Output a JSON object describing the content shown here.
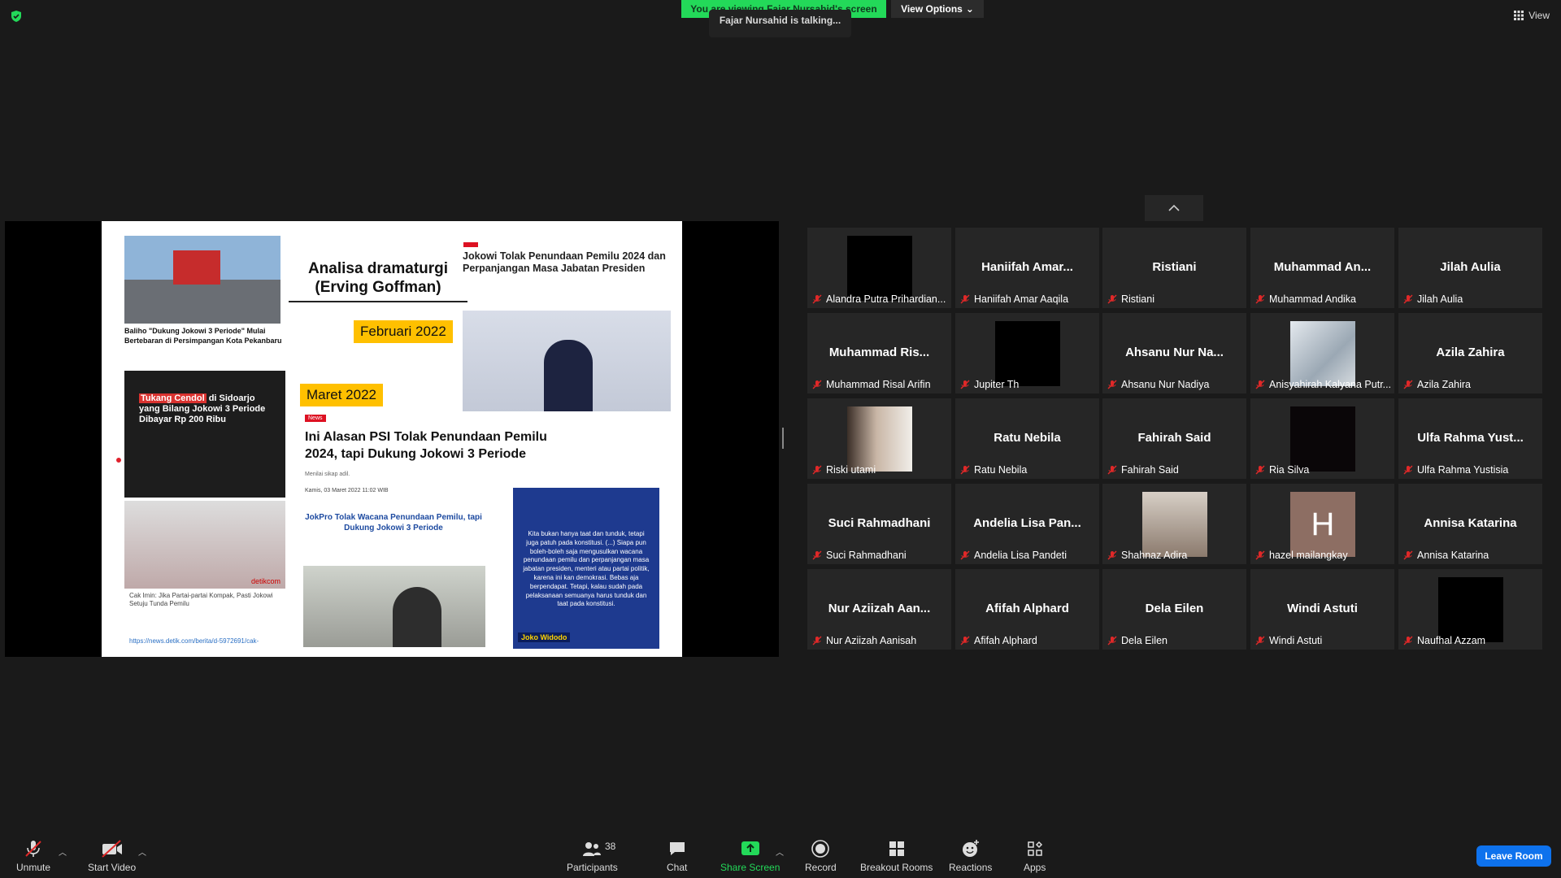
{
  "banner": {
    "viewing": "You are viewing Fajar Nursahid's screen",
    "view_options": "View Options",
    "talking": "Fajar Nursahid is talking...",
    "view": "View"
  },
  "slide": {
    "title": "Analisa dramaturgi (Erving Goffman)",
    "label_feb": "Februari 2022",
    "label_mar": "Maret 2022",
    "cap1": "Baliho \"Dukung Jokowi 3 Periode\" Mulai Bertebaran di Persimpangan Kota Pekanbaru",
    "head2": "Jokowi Tolak Penundaan Pemilu 2024 dan Perpanjangan Masa Jabatan Presiden",
    "dark_hl": "Tukang Cendol",
    "dark_rest": "di Sidoarjo yang Bilang Jokowi 3 Periode Dibayar Rp 200 Ribu",
    "news_tag": "News",
    "head3": "Ini Alasan PSI Tolak Penundaan Pemilu 2024, tapi Dukung Jokowi 3 Periode",
    "sub3": "Menilai sikap adil.",
    "date3": "Kamis, 03 Maret 2022 11:02 WIB",
    "cap4": "Cak Imin: Jika Partai-partai Kompak, Pasti Jokowi Setuju Tunda Pemilu",
    "url": "https://news.detik.com/berita/d-5972691/cak-",
    "head5": "JokPro Tolak Wacana Penundaan Pemilu, tapi Dukung Jokowi 3 Periode",
    "blue_text": "Kita bukan hanya taat dan tunduk, tetapi juga patuh pada konstitusi. (...) Siapa pun boleh-boleh saja mengusulkan wacana penundaan pemilu dan perpanjangan masa jabatan presiden, menteri atau partai politik, karena ini kan demokrasi. Bebas aja berpendapat. Tetapi, kalau sudah pada pelaksanaan semuanya harus tunduk dan taat pada konstitusi.",
    "blue_name": "Joko Widodo"
  },
  "participants": [
    {
      "big": "",
      "name": "Alandra Putra Prihardian..."
    },
    {
      "big": "Haniifah Amar...",
      "name": "Haniifah Amar Aaqila"
    },
    {
      "big": "Ristiani",
      "name": "Ristiani"
    },
    {
      "big": "Muhammad An...",
      "name": "Muhammad Andika"
    },
    {
      "big": "Jilah Aulia",
      "name": "Jilah Aulia"
    },
    {
      "big": "Muhammad Ris...",
      "name": "Muhammad Risal Arifin"
    },
    {
      "big": "",
      "name": "Jupiter Th"
    },
    {
      "big": "Ahsanu Nur Na...",
      "name": "Ahsanu Nur Nadiya"
    },
    {
      "big": "",
      "name": "Anisyahirah Kalyana Putr..."
    },
    {
      "big": "Azila Zahira",
      "name": "Azila Zahira"
    },
    {
      "big": "",
      "name": "Riski utami"
    },
    {
      "big": "Ratu Nebila",
      "name": "Ratu Nebila"
    },
    {
      "big": "Fahirah Said",
      "name": "Fahirah Said"
    },
    {
      "big": "",
      "name": "Ria Silva"
    },
    {
      "big": "Ulfa Rahma Yust...",
      "name": "Ulfa Rahma Yustisia"
    },
    {
      "big": "Suci Rahmadhani",
      "name": "Suci Rahmadhani"
    },
    {
      "big": "Andelia Lisa Pan...",
      "name": "Andelia Lisa Pandeti"
    },
    {
      "big": "",
      "name": "Shahnaz Adira"
    },
    {
      "big": "H",
      "name": "hazel mailangkay"
    },
    {
      "big": "Annisa Katarina",
      "name": "Annisa Katarina"
    },
    {
      "big": "Nur Aziizah Aan...",
      "name": "Nur Aziizah Aanisah"
    },
    {
      "big": "Afifah Alphard",
      "name": "Afifah Alphard"
    },
    {
      "big": "Dela Eilen",
      "name": "Dela Eilen"
    },
    {
      "big": "Windi Astuti",
      "name": "Windi Astuti"
    },
    {
      "big": "",
      "name": "Naufhal Azzam"
    }
  ],
  "toolbar": {
    "unmute": "Unmute",
    "start_video": "Start Video",
    "participants": "Participants",
    "participants_count": "38",
    "chat": "Chat",
    "share_screen": "Share Screen",
    "record": "Record",
    "breakout": "Breakout Rooms",
    "reactions": "Reactions",
    "apps": "Apps",
    "leave": "Leave Room"
  },
  "colors": {
    "banner_green": "#23d959",
    "share_green": "#23d959",
    "leave_blue": "#0e72ed",
    "muted_red": "#e02828"
  }
}
